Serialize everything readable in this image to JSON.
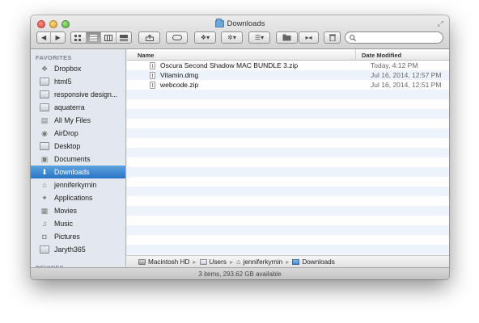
{
  "window": {
    "title": "Downloads"
  },
  "toolbar": {
    "back_label": "◀",
    "forward_label": "▶",
    "search": {
      "placeholder": "",
      "value": ""
    }
  },
  "sidebar": {
    "favorites_header": "FAVORITES",
    "devices_header": "DEVICES",
    "items": [
      {
        "label": "Dropbox",
        "icon": "dropbox-icon"
      },
      {
        "label": "html5",
        "icon": "folder-icon"
      },
      {
        "label": "responsive design...",
        "icon": "folder-icon"
      },
      {
        "label": "aquaterra",
        "icon": "folder-icon"
      },
      {
        "label": "All My Files",
        "icon": "all-files-icon"
      },
      {
        "label": "AirDrop",
        "icon": "airdrop-icon"
      },
      {
        "label": "Desktop",
        "icon": "desktop-icon"
      },
      {
        "label": "Documents",
        "icon": "documents-icon"
      },
      {
        "label": "Downloads",
        "icon": "downloads-icon"
      },
      {
        "label": "jenniferkyrnin",
        "icon": "home-icon"
      },
      {
        "label": "Applications",
        "icon": "applications-icon"
      },
      {
        "label": "Movies",
        "icon": "movies-icon"
      },
      {
        "label": "Music",
        "icon": "music-icon"
      },
      {
        "label": "Pictures",
        "icon": "pictures-icon"
      },
      {
        "label": "Jaryth365",
        "icon": "folder-icon"
      }
    ],
    "selected": "Downloads"
  },
  "file_list": {
    "columns": {
      "name": "Name",
      "date": "Date Modified"
    },
    "files": [
      {
        "name": "Oscura Second Shadow MAC BUNDLE 3.zip",
        "date": "Today, 4:12 PM"
      },
      {
        "name": "Vitamin.dmg",
        "date": "Jul 16, 2014, 12:57 PM"
      },
      {
        "name": "webcode.zip",
        "date": "Jul 16, 2014, 12:51 PM"
      }
    ]
  },
  "path_bar": {
    "segments": [
      {
        "label": "Macintosh HD"
      },
      {
        "label": "Users"
      },
      {
        "label": "jenniferkyrnin"
      },
      {
        "label": "Downloads"
      }
    ]
  },
  "status": {
    "text": "3 items, 293.62 GB available"
  },
  "colors": {
    "selection": "#2a73c5",
    "sidebar_bg": "#e3e8ee",
    "row_stripe": "#edf3fb"
  }
}
